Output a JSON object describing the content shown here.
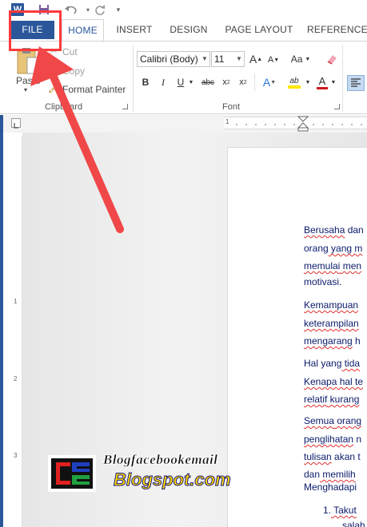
{
  "qat": {
    "app_icon": "word-icon",
    "app_letter": "W",
    "icons": [
      "save-icon",
      "undo-icon",
      "redo-icon",
      "customize-icon"
    ]
  },
  "tabs": [
    "FILE",
    "HOME",
    "INSERT",
    "DESIGN",
    "PAGE LAYOUT",
    "REFERENCES"
  ],
  "clipboard": {
    "paste": "Paste",
    "cut": "Cut",
    "copy": "Copy",
    "format_painter": "Format Painter",
    "group_label": "Clipboard"
  },
  "font": {
    "name": "Calibri (Body)",
    "size": "11",
    "grow": "A",
    "shrink": "A",
    "case": "Aa",
    "bold": "B",
    "italic": "I",
    "underline": "U",
    "strike": "abc",
    "subscript": "x",
    "sub_mark": "2",
    "superscript": "x",
    "sup_mark": "2",
    "effects": "A",
    "highlight": "ab",
    "color": "A",
    "group_label": "Font"
  },
  "ruler": {
    "number": "1"
  },
  "vruler_numbers": [
    "1",
    "2",
    "3"
  ],
  "document": {
    "lines": [
      [
        [
          "Berusaha",
          true
        ],
        [
          " dan",
          false
        ]
      ],
      [
        [
          "orang",
          false
        ],
        [
          " yang m",
          true
        ]
      ],
      [
        [
          "memulai",
          true
        ],
        [
          " men",
          true
        ]
      ],
      [
        [
          "motivasi.",
          false
        ]
      ],
      [
        [
          "Kemampuan",
          true
        ]
      ],
      [
        [
          "keterampilan",
          true
        ]
      ],
      [
        [
          "mengarang",
          true
        ],
        [
          " h",
          false
        ]
      ],
      [
        [
          "Hal yang",
          false
        ],
        [
          " tida",
          true
        ]
      ],
      [
        [
          "Kenapa",
          true
        ],
        [
          " hal te",
          true
        ]
      ],
      [
        [
          "relatif",
          true
        ],
        [
          " kurang",
          true
        ]
      ],
      [
        [
          "Semua",
          true
        ],
        [
          " orang",
          true
        ]
      ],
      [
        [
          "penglihatan",
          true
        ],
        [
          " n",
          false
        ]
      ],
      [
        [
          "tulisan",
          true
        ],
        [
          " akan t",
          false
        ]
      ],
      [
        [
          "dan",
          false
        ],
        [
          " memilih",
          true
        ]
      ],
      [
        [
          "Menghadapi",
          false
        ]
      ],
      [
        [
          "1.",
          false
        ],
        [
          "      Takut",
          true
        ]
      ],
      [
        [
          "salah",
          true
        ]
      ]
    ]
  },
  "watermark": {
    "line1": "Blogfacebookemail",
    "line2": "Blogspot.com"
  },
  "colors": {
    "brand": "#2b579a",
    "annotation": "#ff3a3a",
    "text": "#0a1a6a"
  }
}
